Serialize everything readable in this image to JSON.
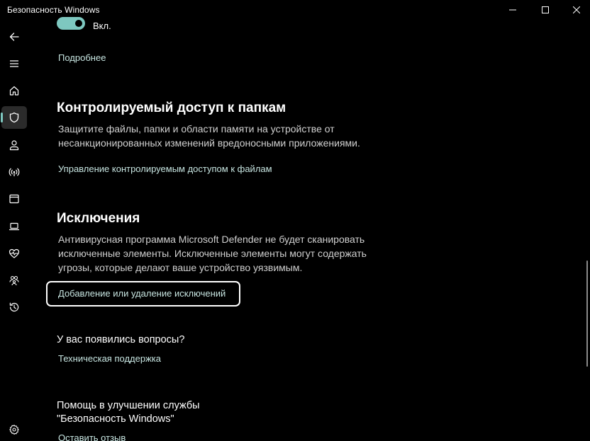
{
  "window": {
    "title": "Безопасность Windows"
  },
  "colors": {
    "background": "#000000",
    "accent": "#7ec8c0",
    "link": "#c8e6e2",
    "text": "#ffffff",
    "muted_text": "#d0d0d0"
  },
  "nav": {
    "items": [
      {
        "icon": "back-arrow-icon"
      },
      {
        "icon": "hamburger-menu-icon"
      },
      {
        "icon": "home-icon"
      },
      {
        "icon": "shield-icon",
        "active": true
      },
      {
        "icon": "person-icon"
      },
      {
        "icon": "wifi-antenna-icon"
      },
      {
        "icon": "app-browser-icon"
      },
      {
        "icon": "laptop-icon"
      },
      {
        "icon": "heart-pulse-icon"
      },
      {
        "icon": "family-icon"
      },
      {
        "icon": "history-icon"
      },
      {
        "icon": "settings-gear-icon"
      }
    ]
  },
  "toggle": {
    "state": "on",
    "label": "Вкл."
  },
  "more_link": "Подробнее",
  "controlled_folder": {
    "heading": "Контролируемый доступ к папкам",
    "description": "Защитите файлы, папки и области памяти на устройстве от несанкционированных изменений вредоносными приложениями.",
    "link": "Управление контролируемым доступом к файлам"
  },
  "exclusions": {
    "heading": "Исключения",
    "description": "Антивирусная программа Microsoft Defender не будет сканировать исключенные элементы. Исключенные элементы могут содержать угрозы, которые делают ваше устройство уязвимым.",
    "link": "Добавление или удаление исключений"
  },
  "questions": {
    "heading": "У вас появились вопросы?",
    "link": "Техническая поддержка"
  },
  "feedback": {
    "heading_line1": "Помощь в улучшении службы",
    "heading_line2": "\"Безопасность Windows\"",
    "link": "Оставить отзыв"
  }
}
